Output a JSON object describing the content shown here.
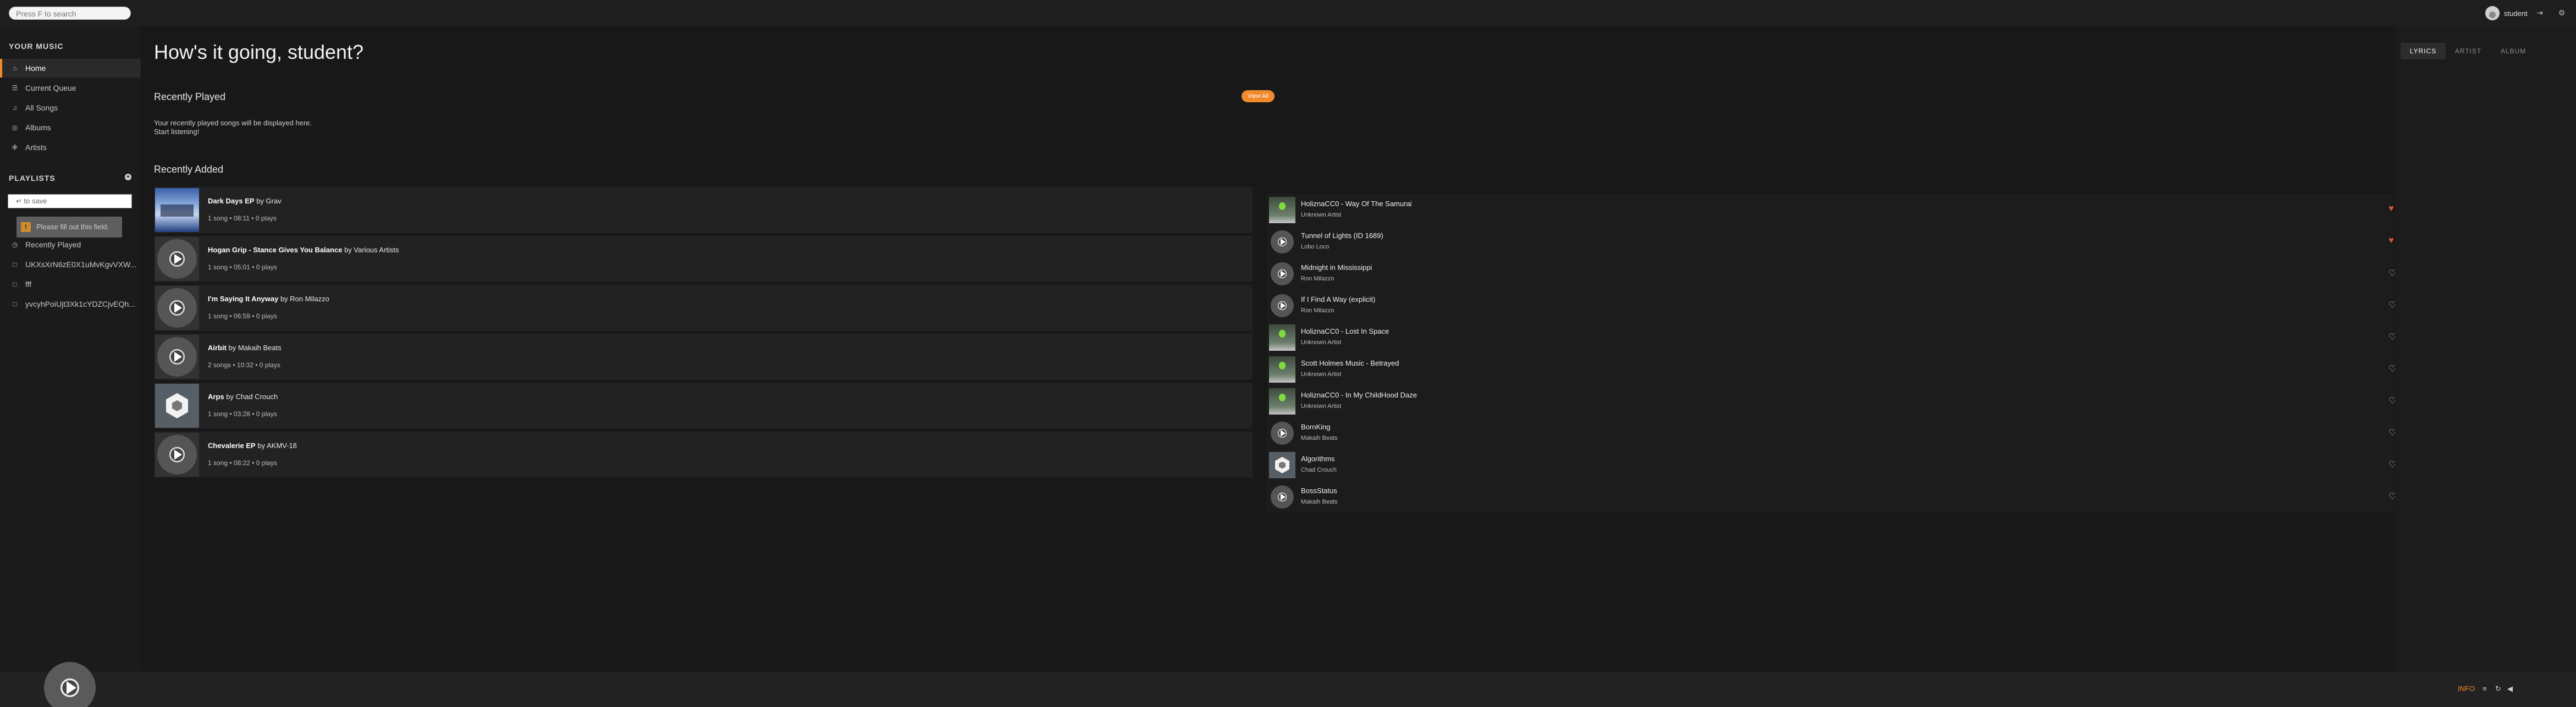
{
  "header": {
    "search_placeholder": "Press F to search",
    "username": "student",
    "icons": [
      "login-icon",
      "settings-icon"
    ]
  },
  "sidebar": {
    "your_music_heading": "YOUR MUSIC",
    "music_items": [
      {
        "label": "Home",
        "icon": "home-icon",
        "active": true
      },
      {
        "label": "Current Queue",
        "icon": "queue-icon",
        "active": false
      },
      {
        "label": "All Songs",
        "icon": "music-note-icon",
        "active": false
      },
      {
        "label": "Albums",
        "icon": "disc-icon",
        "active": false
      },
      {
        "label": "Artists",
        "icon": "microphone-icon",
        "active": false
      }
    ],
    "playlists_heading": "PLAYLISTS",
    "playlist_input_placeholder": "↵ to save",
    "validation_message": "Please fill out this field.",
    "playlist_items": [
      {
        "label": "Recently Played",
        "icon": "clock-icon"
      },
      {
        "label": "UKXsXrN6zE0X1uMvKgvVXW...",
        "icon": "file-icon"
      },
      {
        "label": "fff",
        "icon": "file-icon"
      },
      {
        "label": "yvcyhPoiUjt3Xk1cYDZCjvEQh...",
        "icon": "file-icon"
      }
    ]
  },
  "main": {
    "greeting": "How's it going, student?",
    "recently_played_title": "Recently Played",
    "view_all_label": "View All",
    "empty_line1": "Your recently played songs will be displayed here.",
    "empty_line2": "Start listening!",
    "recently_added_title": "Recently Added",
    "albums": [
      {
        "name": "Dark Days EP",
        "by": "by",
        "artist": "Grav",
        "meta": "1 song • 08:11 • 0 plays",
        "cover": "photo"
      },
      {
        "name": "Hogan Grip - Stance Gives You Balance",
        "by": "by",
        "artist": "Various Artists",
        "meta": "1 song • 05:01 • 0 plays",
        "cover": "disc"
      },
      {
        "name": "I'm Saying It Anyway",
        "by": "by",
        "artist": "Ron Milazzo",
        "meta": "1 song • 06:59 • 0 plays",
        "cover": "disc"
      },
      {
        "name": "Airbit",
        "by": "by",
        "artist": "Makaih Beats",
        "meta": "2 songs • 10:32 • 0 plays",
        "cover": "disc"
      },
      {
        "name": "Arps",
        "by": "by",
        "artist": "Chad Crouch",
        "meta": "1 song • 03:28 • 0 plays",
        "cover": "hex"
      },
      {
        "name": "Chevalerie EP",
        "by": "by",
        "artist": "AKMV-18",
        "meta": "1 song • 08:22 • 0 plays",
        "cover": "disc"
      }
    ],
    "songs": [
      {
        "title": "HoliznaCC0 - Way Of The Samurai",
        "artist": "Unknown Artist",
        "thumb": "tree",
        "favorite": true
      },
      {
        "title": "Tunnel of Lights (ID 1689)",
        "artist": "Lobo Loco",
        "thumb": "disc",
        "favorite": true
      },
      {
        "title": "Midnight in Mississippi",
        "artist": "Ron Milazzo",
        "thumb": "disc",
        "favorite": false
      },
      {
        "title": "If I Find A Way (explicit)",
        "artist": "Ron Milazzo",
        "thumb": "disc",
        "favorite": false
      },
      {
        "title": "HoliznaCC0 - Lost In Space",
        "artist": "Unknown Artist",
        "thumb": "tree",
        "favorite": false
      },
      {
        "title": "Scott Holmes Music - Betrayed",
        "artist": "Unknown Artist",
        "thumb": "tree",
        "favorite": false
      },
      {
        "title": "HoliznaCC0 - In My ChildHood Daze",
        "artist": "Unknown Artist",
        "thumb": "tree",
        "favorite": false
      },
      {
        "title": "BornKing",
        "artist": "Makaih Beats",
        "thumb": "disc",
        "favorite": false
      },
      {
        "title": "Algorithms",
        "artist": "Chad Crouch",
        "thumb": "hex",
        "favorite": false
      },
      {
        "title": "BossStatus",
        "artist": "Makaih Beats",
        "thumb": "disc",
        "favorite": false
      }
    ]
  },
  "right_panel": {
    "tabs": [
      {
        "label": "LYRICS",
        "active": true
      },
      {
        "label": "ARTIST",
        "active": false
      },
      {
        "label": "ALBUM",
        "active": false
      }
    ]
  },
  "footer": {
    "info_label": "INFO",
    "icons": [
      "equalizer-icon",
      "repeat-icon",
      "volume-icon"
    ]
  },
  "colors": {
    "accent": "#f08a2c",
    "favorite": "#e0524a",
    "background": "#181818"
  }
}
